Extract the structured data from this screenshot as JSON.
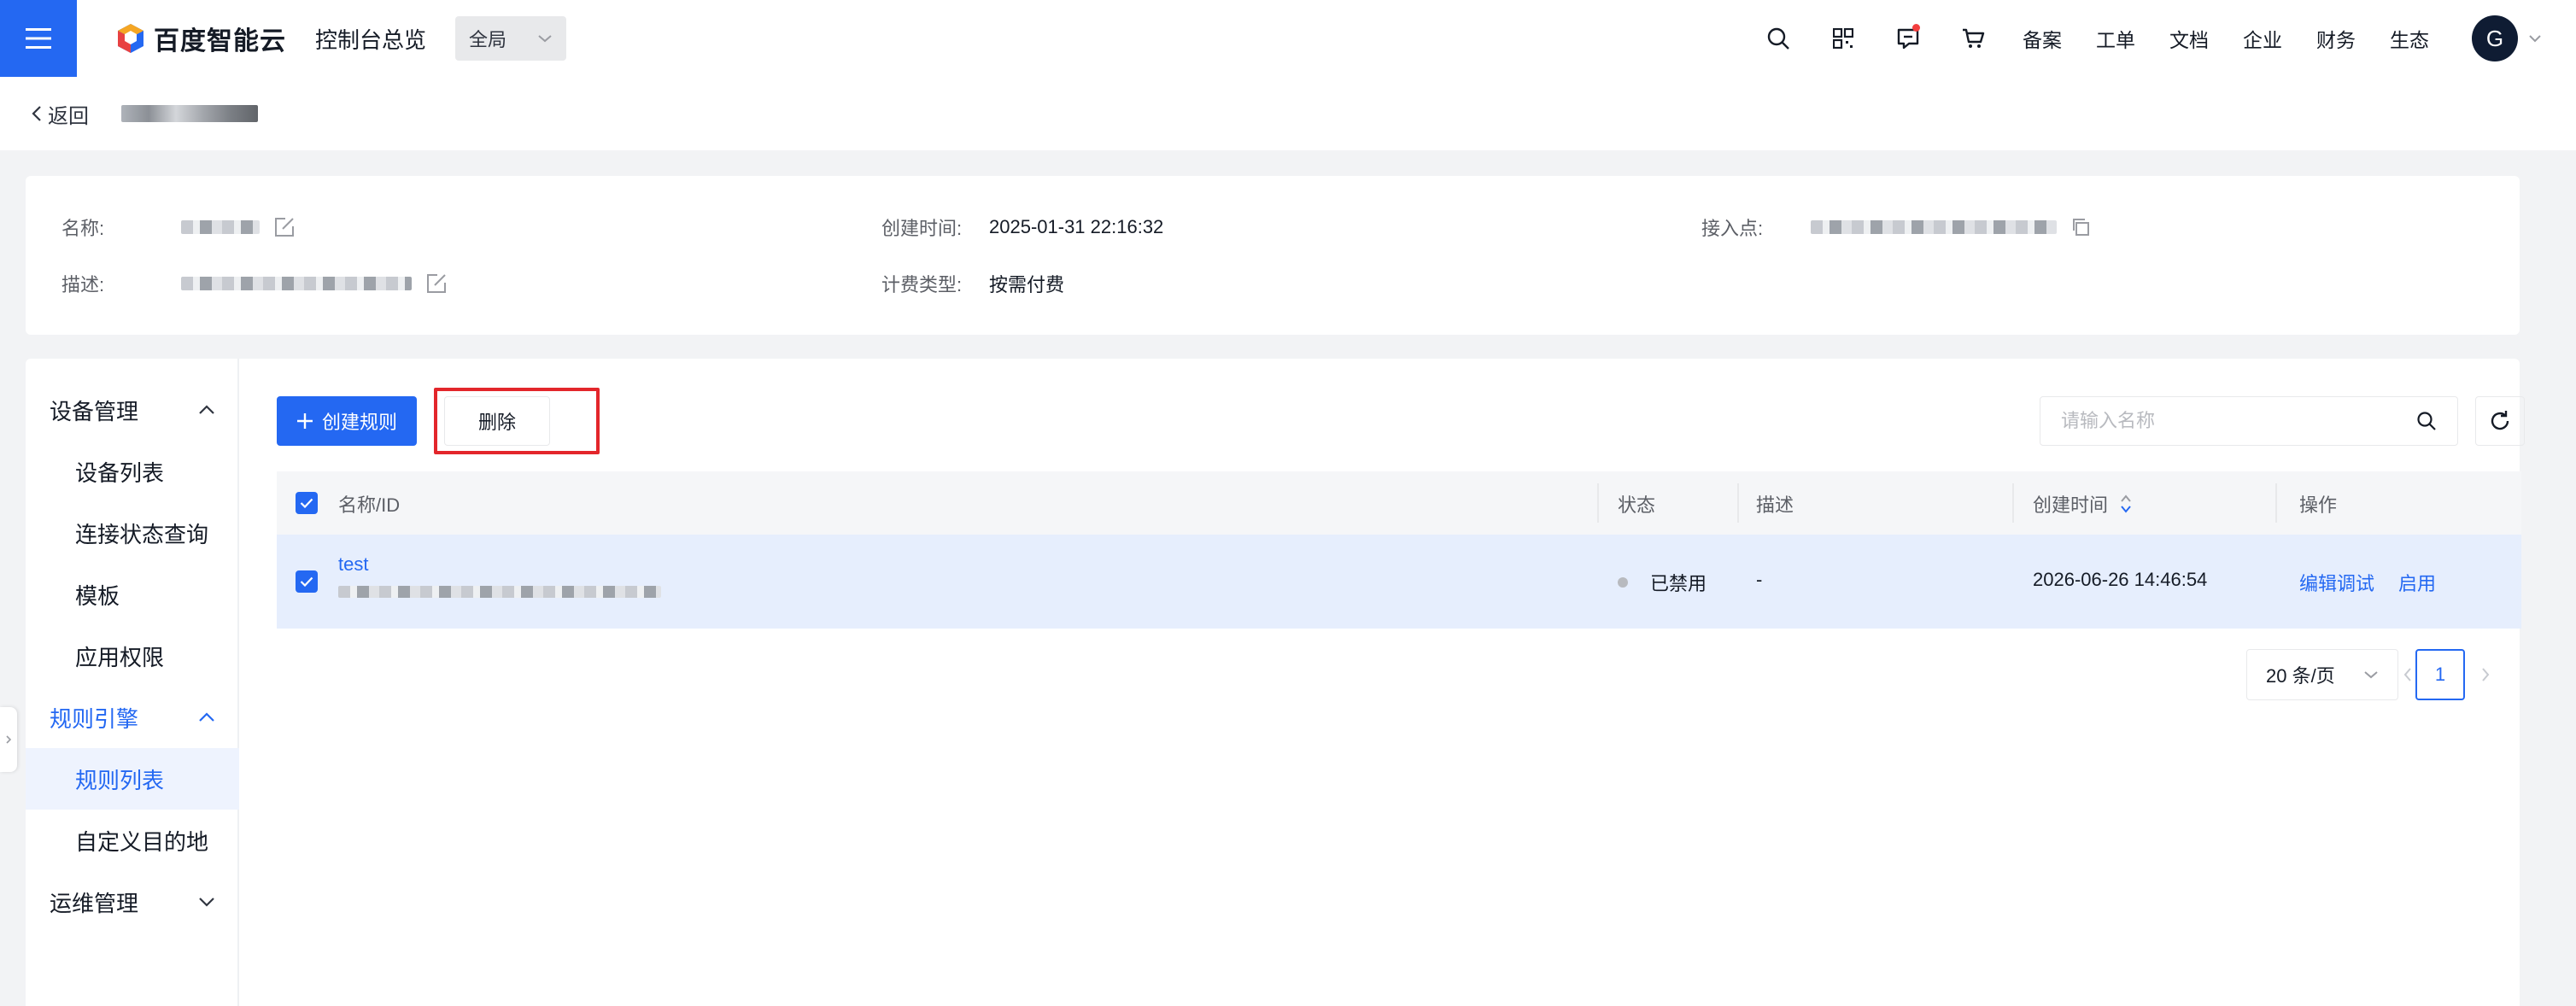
{
  "header": {
    "brand": "百度智能云",
    "console_title": "控制台总览",
    "region": "全局",
    "links": [
      "备案",
      "工单",
      "文档",
      "企业",
      "财务",
      "生态"
    ],
    "avatar_letter": "G",
    "accent": "#2468f2"
  },
  "back": {
    "label": "返回"
  },
  "info": {
    "name_label": "名称:",
    "desc_label": "描述:",
    "created_label": "创建时间:",
    "created_value": "2025-01-31 22:16:32",
    "billing_label": "计费类型:",
    "billing_value": "按需付费",
    "endpoint_label": "接入点:"
  },
  "sidebar": {
    "groups": [
      {
        "label": "设备管理",
        "expanded": true,
        "items": [
          "设备列表",
          "连接状态查询",
          "模板",
          "应用权限"
        ]
      },
      {
        "label": "规则引擎",
        "expanded": true,
        "active": true,
        "items": [
          "规则列表",
          "自定义目的地"
        ]
      },
      {
        "label": "运维管理",
        "expanded": false,
        "items": []
      }
    ],
    "selected_item": "规则列表"
  },
  "toolbar": {
    "create_label": "创建规则",
    "delete_label": "删除",
    "search_placeholder": "请输入名称",
    "highlight_color": "#e3262b"
  },
  "table": {
    "columns": [
      "名称/ID",
      "状态",
      "描述",
      "创建时间",
      "操作"
    ],
    "rows": [
      {
        "name": "test",
        "status": "已禁用",
        "description": "-",
        "created": "2026-06-26 14:46:54",
        "actions": [
          "编辑调试",
          "启用"
        ],
        "checked": true
      }
    ]
  },
  "pager": {
    "page_size": "20 条/页",
    "current_page": "1"
  }
}
